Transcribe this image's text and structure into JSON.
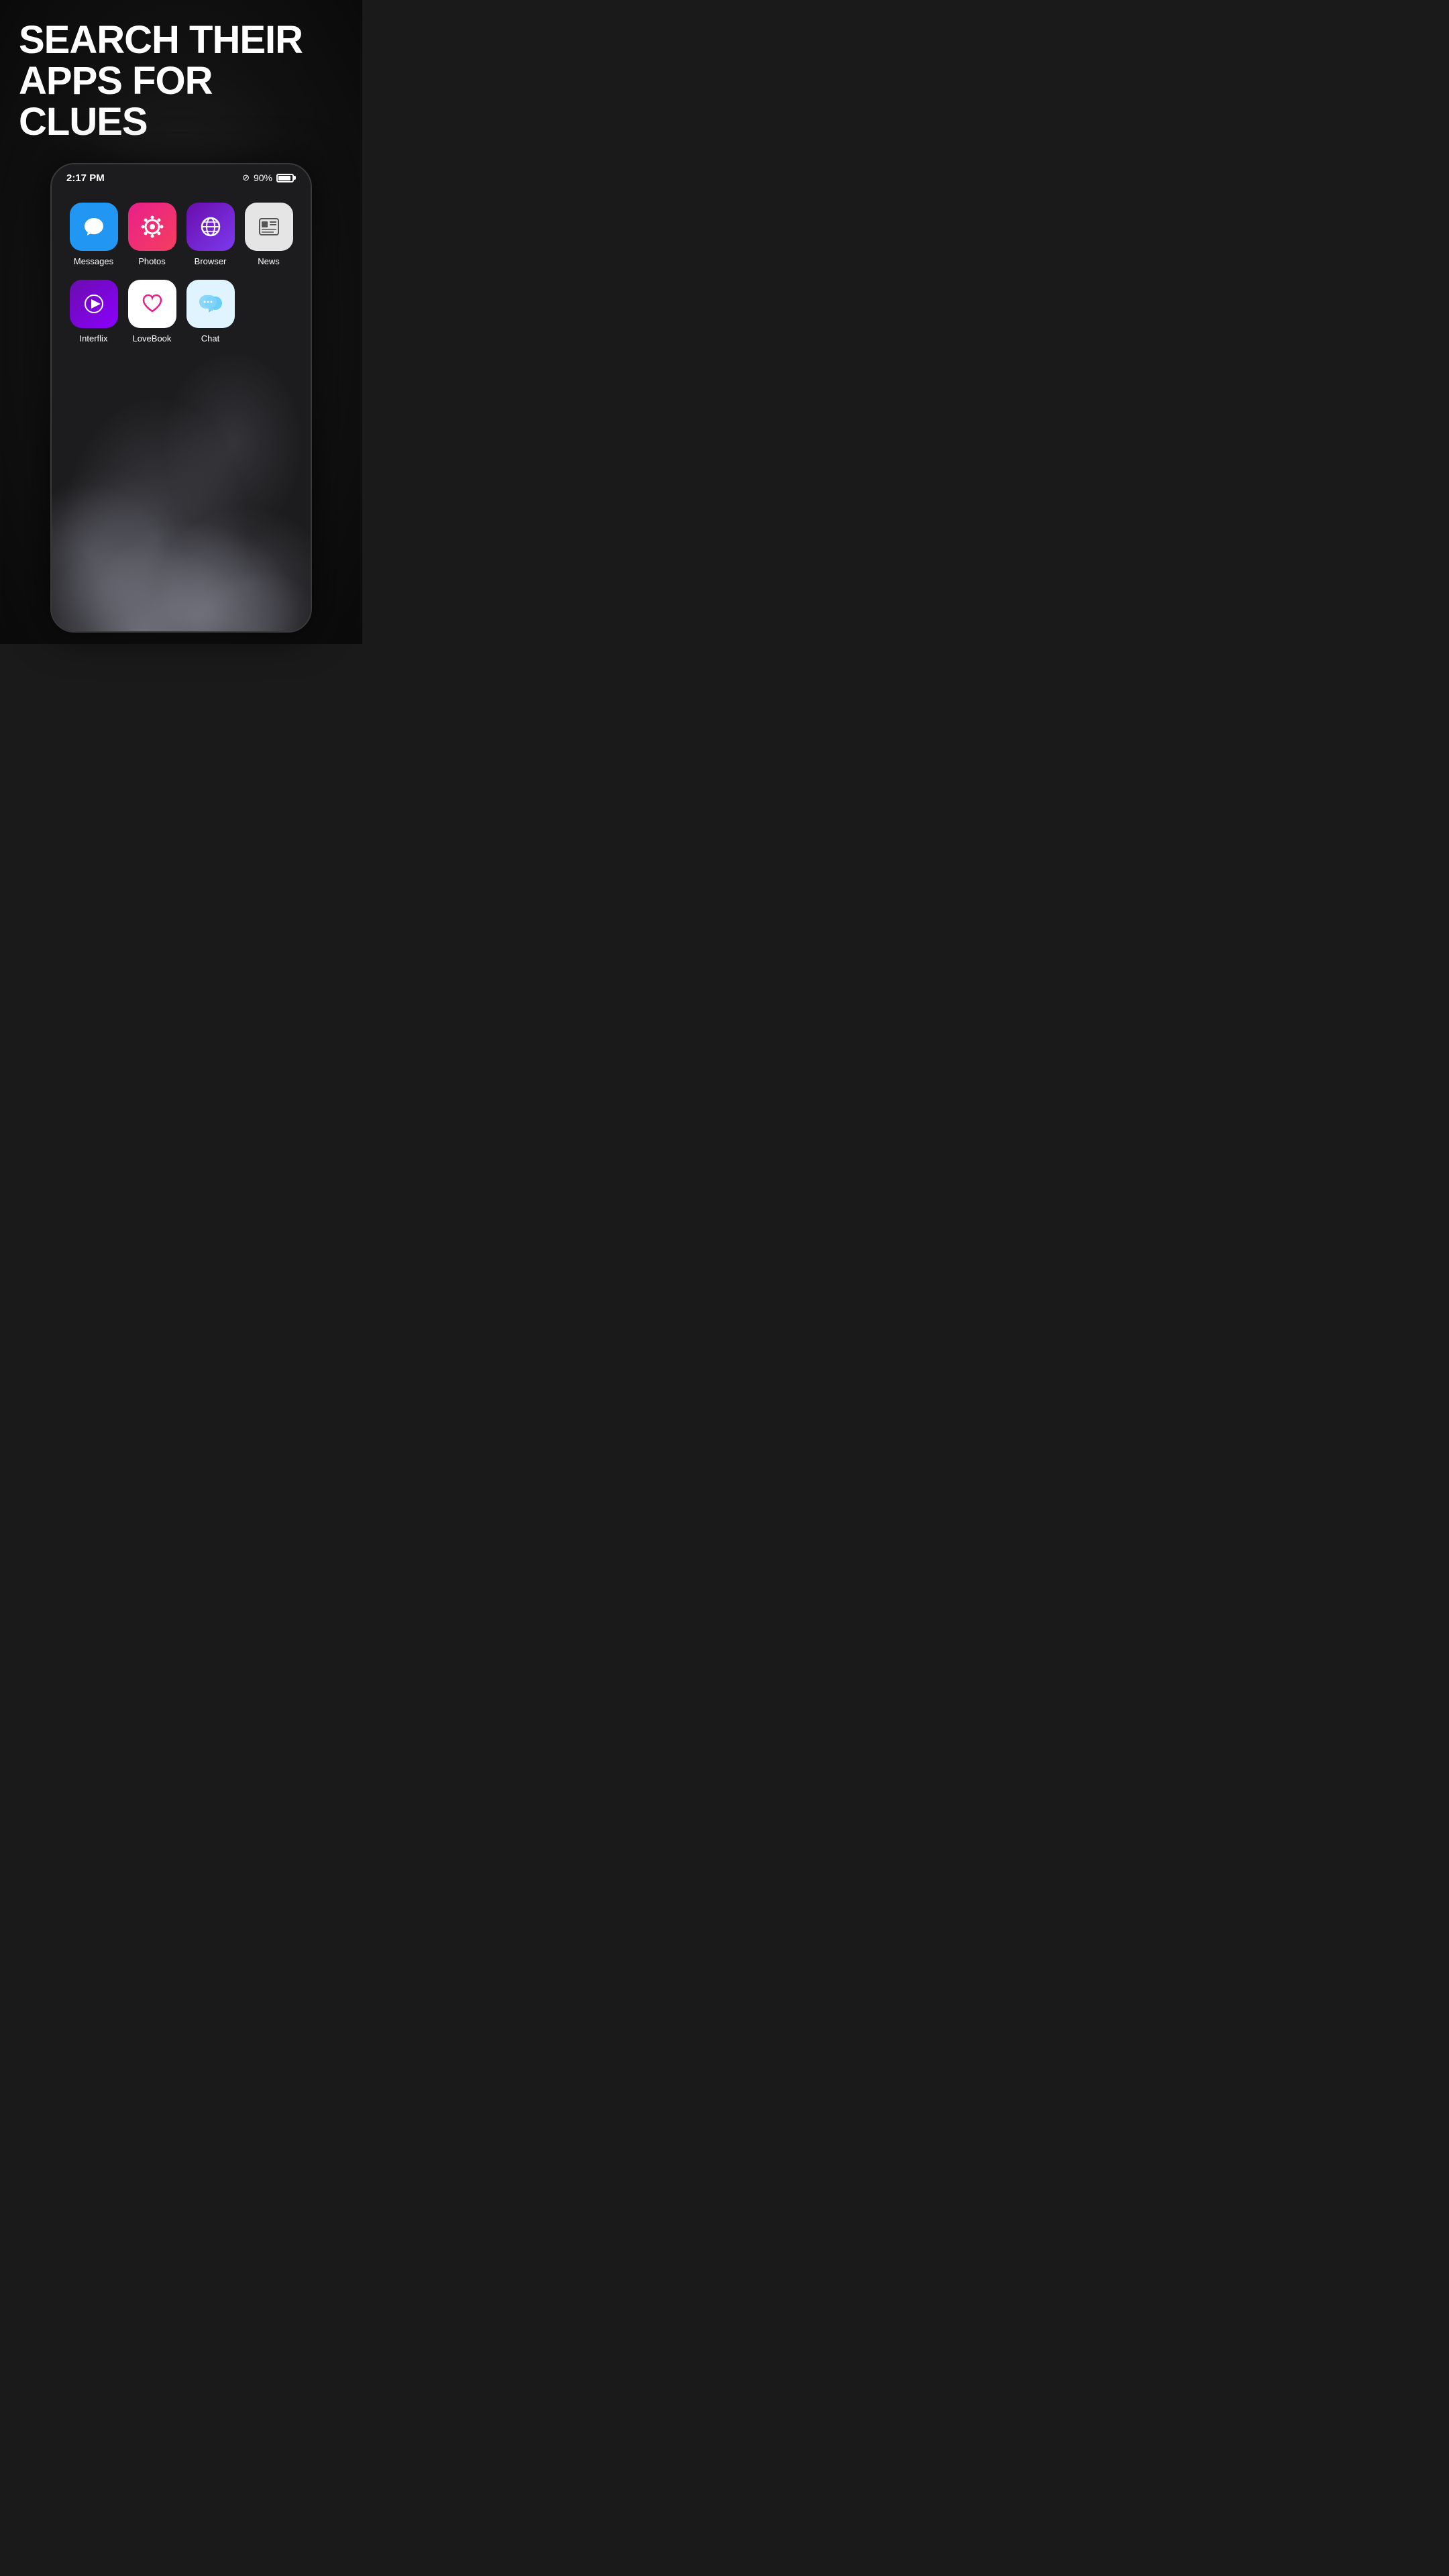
{
  "page": {
    "bg_color": "#1a1a1a"
  },
  "header": {
    "line1": "SEARCH THEIR",
    "line2": "APPS FOR CLUES"
  },
  "status_bar": {
    "time": "2:17 PM",
    "battery_pct": "90%",
    "no_signal_icon": "⊘"
  },
  "apps_row1": [
    {
      "id": "messages",
      "label": "Messages",
      "icon_bg": "#2196F3",
      "icon_type": "messages"
    },
    {
      "id": "photos",
      "label": "Photos",
      "icon_bg": "gradient-pink",
      "icon_type": "photos"
    },
    {
      "id": "browser",
      "label": "Browser",
      "icon_bg": "gradient-purple",
      "icon_type": "browser"
    },
    {
      "id": "news",
      "label": "News",
      "icon_bg": "#e5e5e5",
      "icon_type": "news"
    }
  ],
  "apps_row2": [
    {
      "id": "interflix",
      "label": "Interflix",
      "icon_bg": "gradient-purple2",
      "icon_type": "interflix"
    },
    {
      "id": "lovebook",
      "label": "LoveBook",
      "icon_bg": "#ffffff",
      "icon_type": "lovebook"
    },
    {
      "id": "chat",
      "label": "Chat",
      "icon_bg": "#e0f4ff",
      "icon_type": "chat"
    }
  ]
}
